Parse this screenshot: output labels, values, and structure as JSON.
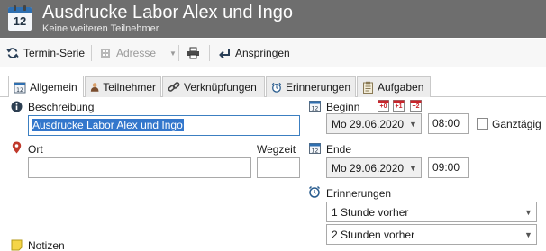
{
  "header": {
    "app_icon_number": "12",
    "title": "Ausdrucke Labor Alex und Ingo",
    "subtitle": "Keine weiteren Teilnehmer"
  },
  "toolbar": {
    "series_label": "Termin-Serie",
    "address_label": "Adresse",
    "jump_label": "Anspringen"
  },
  "tabs": [
    {
      "label": "Allgemein",
      "icon": "calendar-icon"
    },
    {
      "label": "Teilnehmer",
      "icon": "person-icon"
    },
    {
      "label": "Verknüpfungen",
      "icon": "link-icon"
    },
    {
      "label": "Erinnerungen",
      "icon": "alarm-clock-icon"
    },
    {
      "label": "Aufgaben",
      "icon": "clipboard-icon"
    }
  ],
  "form": {
    "description_label": "Beschreibung",
    "description_value": "Ausdrucke Labor Alex und Ingo",
    "location_label": "Ort",
    "location_value": "",
    "travel_label": "Wegzeit",
    "travel_value": "",
    "begin_label": "Beginn",
    "begin_shortcuts": [
      "+0",
      "+1",
      "+2"
    ],
    "begin_date": "Mo 29.06.2020",
    "begin_time": "08:00",
    "allday_label": "Ganztägig",
    "allday_checked": false,
    "end_label": "Ende",
    "end_date": "Mo 29.06.2020",
    "end_time": "09:00",
    "reminders_label": "Erinnerungen",
    "reminder_1": "1 Stunde vorher",
    "reminder_2": "2 Stunden vorher",
    "notes_label": "Notizen"
  },
  "colors": {
    "header_bg": "#6e6e6e",
    "accent_blue": "#3377cc",
    "calendar_red": "#c8262c",
    "location_pin": "#c0392b"
  }
}
